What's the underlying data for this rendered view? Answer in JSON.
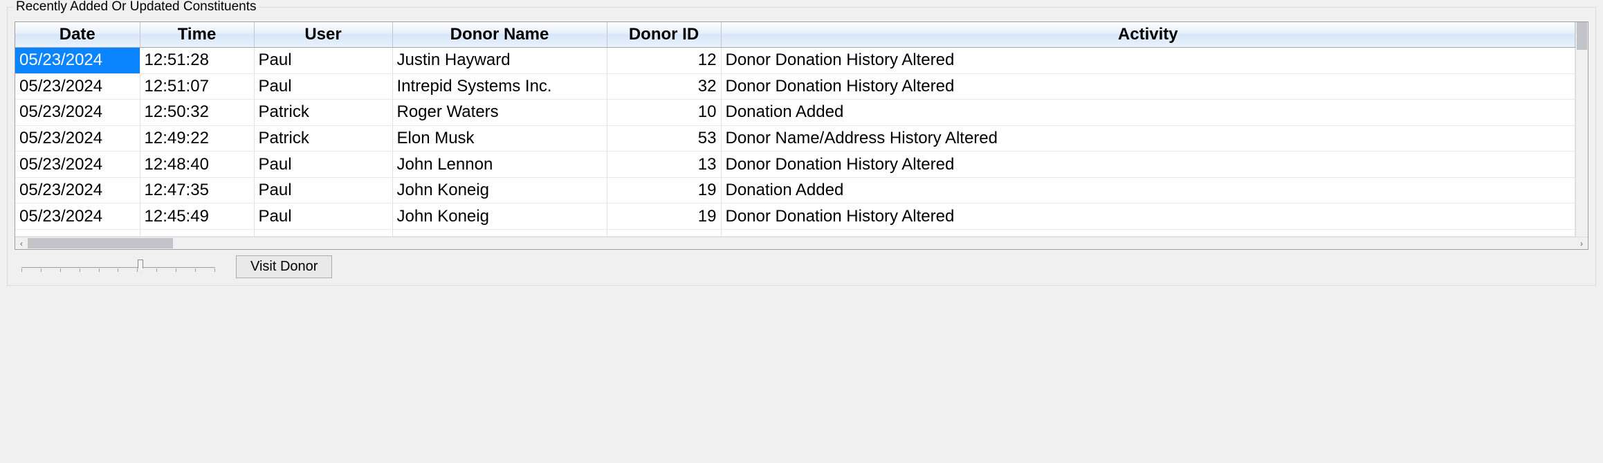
{
  "group_title": "Recently Added Or Updated Constituents",
  "columns": {
    "date": "Date",
    "time": "Time",
    "user": "User",
    "donor_name": "Donor Name",
    "donor_id": "Donor ID",
    "activity": "Activity"
  },
  "rows": [
    {
      "date": "05/23/2024",
      "time": "12:51:28",
      "user": "Paul",
      "donor_name": "Justin Hayward",
      "donor_id": "12",
      "activity": "Donor Donation History Altered"
    },
    {
      "date": "05/23/2024",
      "time": "12:51:07",
      "user": "Paul",
      "donor_name": "Intrepid Systems Inc.",
      "donor_id": "32",
      "activity": "Donor Donation History Altered"
    },
    {
      "date": "05/23/2024",
      "time": "12:50:32",
      "user": "Patrick",
      "donor_name": "Roger Waters",
      "donor_id": "10",
      "activity": "Donation Added"
    },
    {
      "date": "05/23/2024",
      "time": "12:49:22",
      "user": "Patrick",
      "donor_name": "Elon Musk",
      "donor_id": "53",
      "activity": "Donor Name/Address History Altered"
    },
    {
      "date": "05/23/2024",
      "time": "12:48:40",
      "user": "Paul",
      "donor_name": "John Lennon",
      "donor_id": "13",
      "activity": "Donor Donation History Altered"
    },
    {
      "date": "05/23/2024",
      "time": "12:47:35",
      "user": "Paul",
      "donor_name": "John Koneig",
      "donor_id": "19",
      "activity": "Donation Added"
    },
    {
      "date": "05/23/2024",
      "time": "12:45:49",
      "user": "Paul",
      "donor_name": "John Koneig",
      "donor_id": "19",
      "activity": "Donor Donation History Altered"
    },
    {
      "date": "",
      "time": "",
      "user": "",
      "donor_name": "",
      "donor_id": "",
      "activity": ""
    }
  ],
  "selected_cell": {
    "row": 0,
    "col": "date"
  },
  "buttons": {
    "visit_donor": "Visit Donor"
  }
}
